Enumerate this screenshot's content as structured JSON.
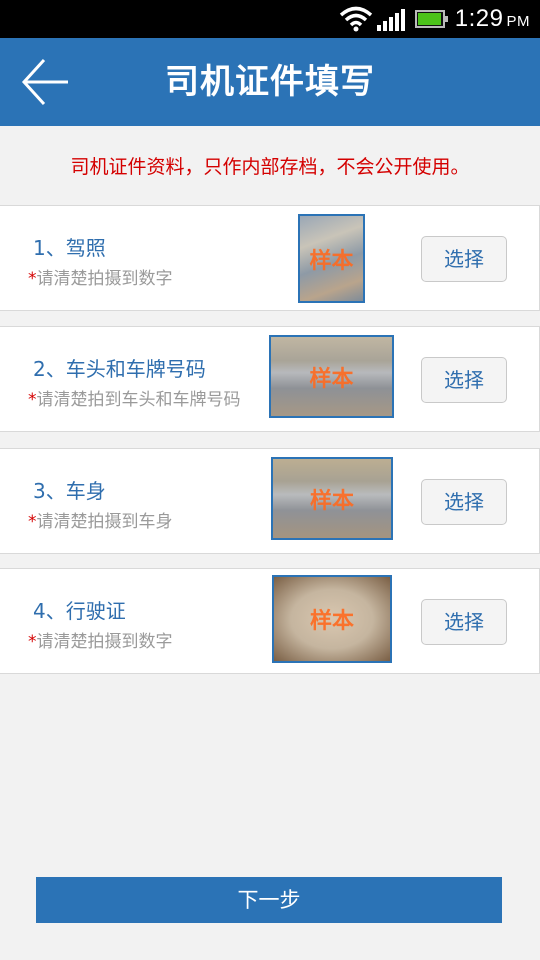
{
  "status_bar": {
    "time": "1:29",
    "ampm": "PM",
    "icons": [
      "wifi-icon",
      "signal-icon",
      "battery-icon"
    ]
  },
  "header": {
    "title": "司机证件填写",
    "back_icon": "back-arrow-icon"
  },
  "notice": "司机证件资料，只作内部存档，不会公开使用。",
  "items": [
    {
      "title": "1、驾照",
      "star": "*",
      "hint": "请清楚拍摄到数字",
      "watermark": "样本",
      "button": "选择"
    },
    {
      "title": "2、车头和车牌号码",
      "star": "*",
      "hint": "请清楚拍到车头和车牌号码",
      "watermark": "样本",
      "button": "选择"
    },
    {
      "title": "3、车身",
      "star": "*",
      "hint": "请清楚拍摄到车身",
      "watermark": "样本",
      "button": "选择"
    },
    {
      "title": "4、行驶证",
      "star": "*",
      "hint": "请清楚拍摄到数字",
      "watermark": "样本",
      "button": "选择"
    }
  ],
  "next_button": "下一步",
  "colors": {
    "primary": "#2b73b6",
    "notice_red": "#d40000",
    "watermark_orange": "#ff6a1f",
    "background": "#f2f2f2"
  }
}
